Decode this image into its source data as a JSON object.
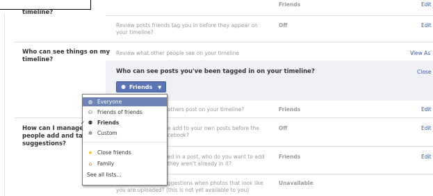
{
  "rows": {
    "tag_review": {
      "title": "timeline?",
      "items": [
        {
          "value": "Friends",
          "action": "Edit"
        },
        {
          "desc_line1": "Review posts friends tag you in before they appear on",
          "desc_line2": "your timeline?",
          "value": "Off",
          "action": "Edit"
        }
      ]
    },
    "see_things": {
      "title_line1": "Who can see things on my",
      "title_line2": "timeline?",
      "review_desc": "Review what other people see on your timeline",
      "review_action": "View As",
      "expanded_question": "Who can see posts you've been tagged in on your timeline?",
      "close_label": "Close",
      "audience_label": "Friends",
      "others_desc": "others post on your timeline?",
      "others_value": "Friends",
      "others_action": "Edit"
    },
    "manage_tags": {
      "title_line1": "How can I manage t",
      "title_line2": "people add and tagg",
      "title_line3": "suggestions?",
      "items": [
        {
          "desc_line1": "e add to your own posts before the",
          "desc_line2": "cebook?",
          "value": "Off",
          "action": "Edit"
        },
        {
          "desc_line1": "ed in a post, who do you want to add",
          "desc_line2": "they aren't already in it?",
          "value": "Friends",
          "action": "Edit"
        },
        {
          "desc_line1": "ggestions when photos that look like",
          "desc_line2": "you are uploaded? (this is not yet available to you)",
          "value": "Unavailable",
          "action": ""
        }
      ]
    }
  },
  "audience_menu": {
    "items": [
      {
        "label": "Everyone",
        "icon": "globe-icon",
        "glyph": "◍",
        "selected": true,
        "checked": false
      },
      {
        "label": "Friends of friends",
        "icon": "friends-of-friends-icon",
        "glyph": "⚇",
        "selected": false,
        "checked": false
      },
      {
        "label": "Friends",
        "icon": "friends-icon",
        "glyph": "⚉",
        "selected": false,
        "checked": true
      },
      {
        "label": "Custom",
        "icon": "gear-icon",
        "glyph": "✲",
        "selected": false,
        "checked": false
      },
      {
        "label": "Close friends",
        "icon": "star-icon",
        "glyph": "★",
        "selected": false,
        "checked": false
      },
      {
        "label": "Family",
        "icon": "house-icon",
        "glyph": "⌂",
        "selected": false,
        "checked": false
      },
      {
        "label": "See all lists...",
        "icon": "",
        "glyph": "",
        "selected": false,
        "checked": false
      }
    ]
  },
  "colors": {
    "link": "#3b5998",
    "selected_bg": "#6d84b4",
    "panel_bg": "#eff1f6",
    "star": "#f5b400"
  }
}
